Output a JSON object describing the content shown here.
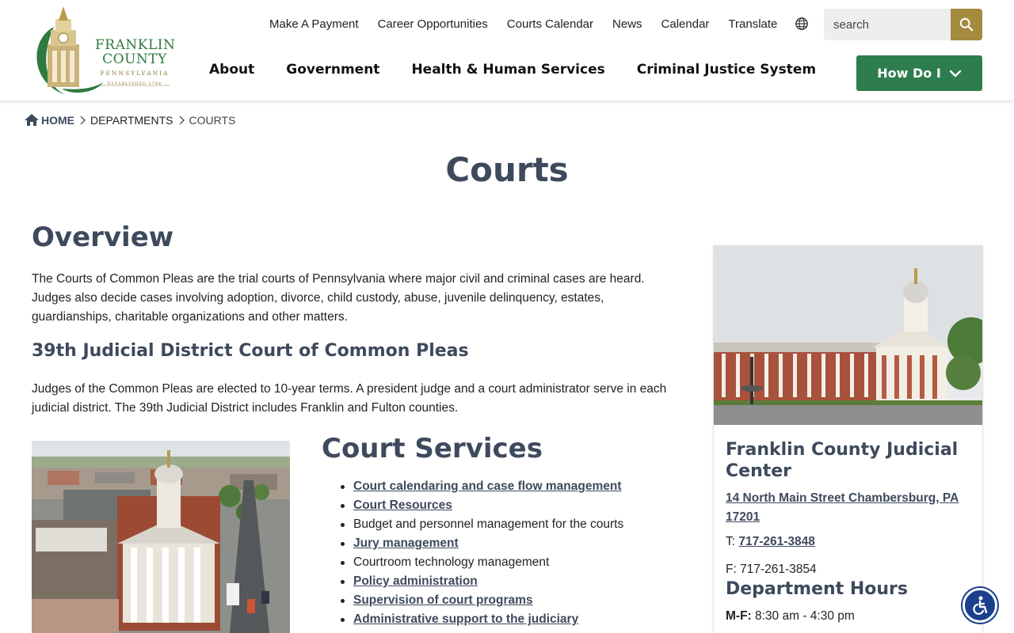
{
  "logo": {
    "line1": "FRANKLIN",
    "line2": "COUNTY",
    "line3": "PENNSYLVANIA",
    "line4": "ESTABLISHED 1784"
  },
  "utility_nav": [
    "Make A Payment",
    "Career Opportunities",
    "Courts Calendar",
    "News",
    "Calendar",
    "Translate"
  ],
  "search": {
    "placeholder": "search"
  },
  "main_nav": [
    "About",
    "Government",
    "Health & Human Services",
    "Criminal Justice System"
  ],
  "how_do_i": "How Do I",
  "breadcrumb": {
    "home": "HOME",
    "departments": "DEPARTMENTS",
    "current": "COURTS"
  },
  "page_title": "Courts",
  "overview": {
    "heading": "Overview",
    "text": "The Courts of Common Pleas are the trial courts of Pennsylvania where major civil and criminal cases are heard. Judges also decide cases involving adoption, divorce, child custody, abuse, juvenile delinquency, estates, guardianships, charitable organizations and other matters."
  },
  "district": {
    "heading": "39th Judicial District Court of Common Pleas",
    "text": "Judges of the Common Pleas are elected to 10-year terms. A president judge and a court administrator serve in each judicial district. The 39th Judicial District includes Franklin and Fulton counties."
  },
  "services": {
    "heading": "Court Services",
    "items": [
      {
        "label": "Court calendaring and case flow management",
        "link": true
      },
      {
        "label": "Court Resources",
        "link": true
      },
      {
        "label": "Budget and personnel management for the courts",
        "link": false
      },
      {
        "label": "Jury management",
        "link": true
      },
      {
        "label": "Courtroom technology management",
        "link": false
      },
      {
        "label": "Policy administration",
        "link": true
      },
      {
        "label": "Supervision of court programs",
        "link": true
      },
      {
        "label": "Administrative support to the judiciary",
        "link": true
      }
    ]
  },
  "card": {
    "title": "Franklin County Judicial Center",
    "address": "14 North Main Street Chambersburg, PA 17201",
    "phone_label": "T: ",
    "phone": "717-261-3848",
    "fax": "F: 717-261-3854",
    "hours_title": "Department Hours",
    "hours_label": "M-F:",
    "hours": " 8:30 am - 4:30 pm"
  },
  "colors": {
    "heading": "#3e4a5c",
    "accent_green": "#2e7d4f",
    "search_gold": "#a48b3e",
    "accessibility_blue": "#1a3f8c"
  }
}
